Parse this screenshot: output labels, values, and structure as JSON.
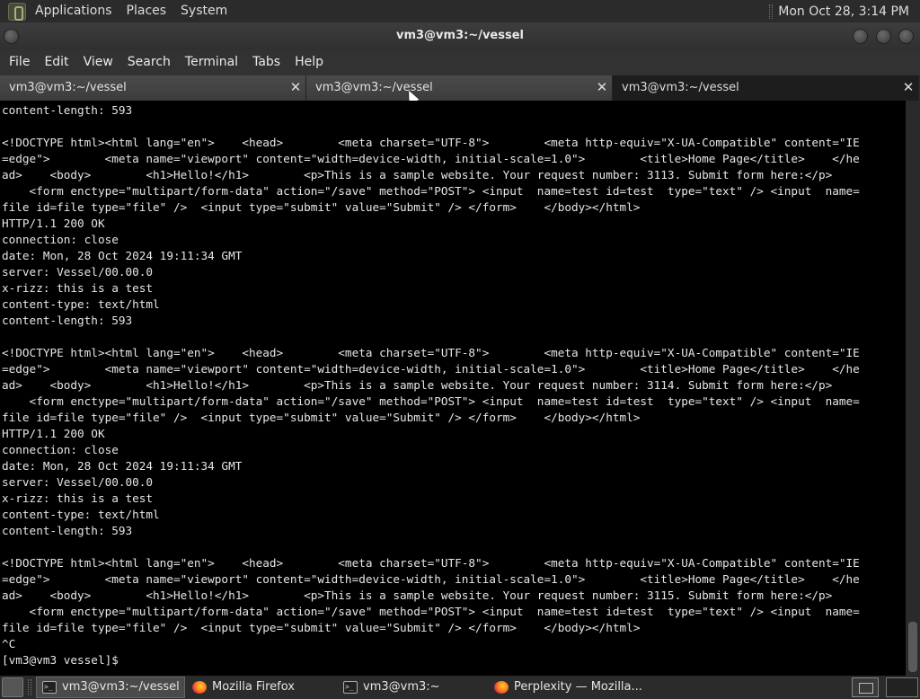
{
  "top_panel": {
    "menus": [
      "Applications",
      "Places",
      "System"
    ],
    "clock": "Mon Oct 28,  3:14 PM"
  },
  "window": {
    "title": "vm3@vm3:~/vessel"
  },
  "menubar": [
    "File",
    "Edit",
    "View",
    "Search",
    "Terminal",
    "Tabs",
    "Help"
  ],
  "tabs": [
    {
      "label": "vm3@vm3:~/vessel",
      "active": false
    },
    {
      "label": "vm3@vm3:~/vessel",
      "active": false
    },
    {
      "label": "vm3@vm3:~/vessel",
      "active": true
    }
  ],
  "terminal": {
    "lines": [
      "content-length: 593",
      "",
      "<!DOCTYPE html><html lang=\"en\">    <head>        <meta charset=\"UTF-8\">        <meta http-equiv=\"X-UA-Compatible\" content=\"IE",
      "=edge\">        <meta name=\"viewport\" content=\"width=device-width, initial-scale=1.0\">        <title>Home Page</title>    </he",
      "ad>    <body>        <h1>Hello!</h1>        <p>This is a sample website. Your request number: 3113. Submit form here:</p>",
      "    <form enctype=\"multipart/form-data\" action=\"/save\" method=\"POST\"> <input  name=test id=test  type=\"text\" /> <input  name=",
      "file id=file type=\"file\" />  <input type=\"submit\" value=\"Submit\" /> </form>    </body></html>",
      "HTTP/1.1 200 OK",
      "connection: close",
      "date: Mon, 28 Oct 2024 19:11:34 GMT",
      "server: Vessel/00.00.0",
      "x-rizz: this is a test",
      "content-type: text/html",
      "content-length: 593",
      "",
      "<!DOCTYPE html><html lang=\"en\">    <head>        <meta charset=\"UTF-8\">        <meta http-equiv=\"X-UA-Compatible\" content=\"IE",
      "=edge\">        <meta name=\"viewport\" content=\"width=device-width, initial-scale=1.0\">        <title>Home Page</title>    </he",
      "ad>    <body>        <h1>Hello!</h1>        <p>This is a sample website. Your request number: 3114. Submit form here:</p>",
      "    <form enctype=\"multipart/form-data\" action=\"/save\" method=\"POST\"> <input  name=test id=test  type=\"text\" /> <input  name=",
      "file id=file type=\"file\" />  <input type=\"submit\" value=\"Submit\" /> </form>    </body></html>",
      "HTTP/1.1 200 OK",
      "connection: close",
      "date: Mon, 28 Oct 2024 19:11:34 GMT",
      "server: Vessel/00.00.0",
      "x-rizz: this is a test",
      "content-type: text/html",
      "content-length: 593",
      "",
      "<!DOCTYPE html><html lang=\"en\">    <head>        <meta charset=\"UTF-8\">        <meta http-equiv=\"X-UA-Compatible\" content=\"IE",
      "=edge\">        <meta name=\"viewport\" content=\"width=device-width, initial-scale=1.0\">        <title>Home Page</title>    </he",
      "ad>    <body>        <h1>Hello!</h1>        <p>This is a sample website. Your request number: 3115. Submit form here:</p>",
      "    <form enctype=\"multipart/form-data\" action=\"/save\" method=\"POST\"> <input  name=test id=test  type=\"text\" /> <input  name=",
      "file id=file type=\"file\" />  <input type=\"submit\" value=\"Submit\" /> </form>    </body></html>",
      "^C",
      "[vm3@vm3 vessel]$ "
    ]
  },
  "taskbar": {
    "tasks": [
      {
        "label": "vm3@vm3:~/vessel",
        "icon": "terminal-icon",
        "active": true
      },
      {
        "label": "Mozilla Firefox",
        "icon": "firefox-icon",
        "active": false
      },
      {
        "label": "vm3@vm3:~",
        "icon": "terminal-icon",
        "active": false
      },
      {
        "label": "Perplexity — Mozilla...",
        "icon": "firefox-icon",
        "active": false
      }
    ]
  }
}
